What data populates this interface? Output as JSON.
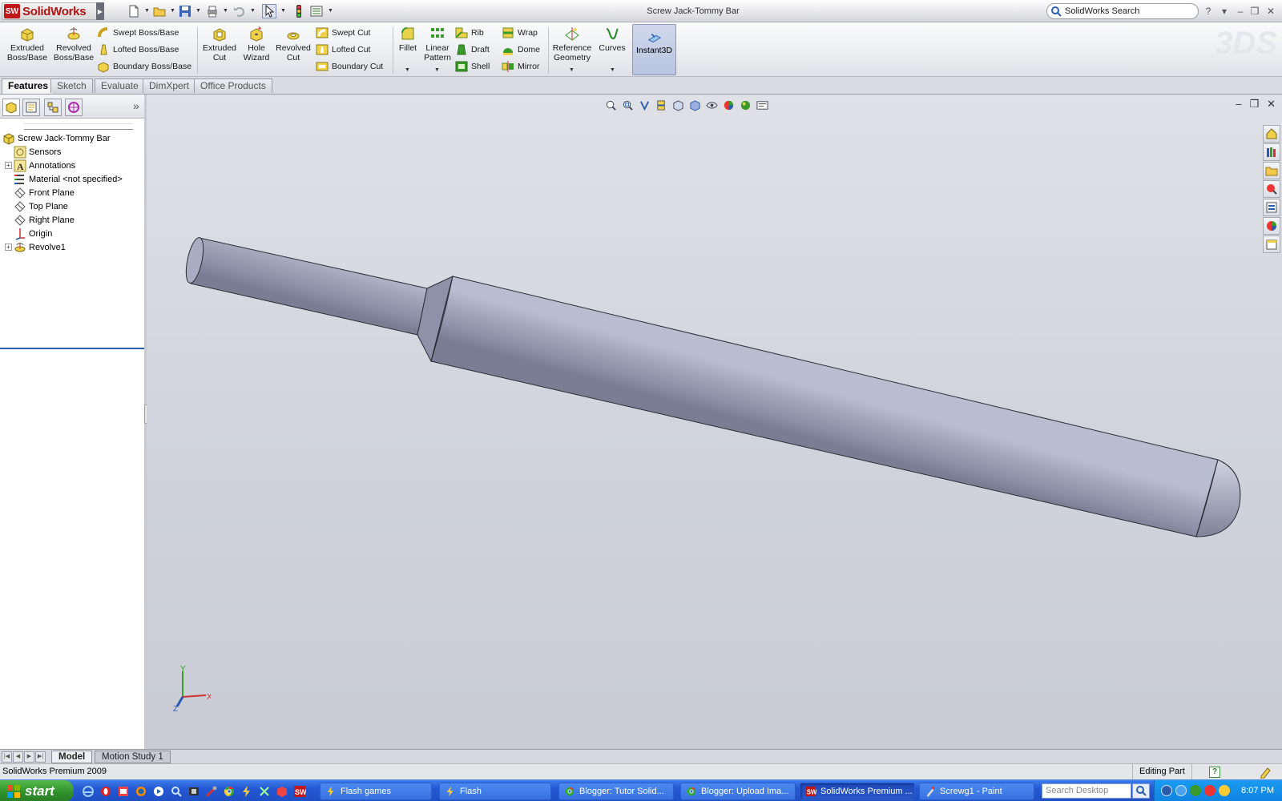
{
  "app": {
    "name": "SolidWorks",
    "badge": "SW"
  },
  "document_title": "Screw Jack-Tommy Bar",
  "search": {
    "placeholder": "SolidWorks Search"
  },
  "command_manager": {
    "extruded_boss": "Extruded Boss/Base",
    "revolved_boss": "Revolved Boss/Base",
    "swept_boss": "Swept Boss/Base",
    "lofted_boss": "Lofted Boss/Base",
    "boundary_boss": "Boundary Boss/Base",
    "extruded_cut": "Extruded Cut",
    "hole_wizard": "Hole Wizard",
    "revolved_cut": "Revolved Cut",
    "swept_cut": "Swept Cut",
    "lofted_cut": "Lofted Cut",
    "boundary_cut": "Boundary Cut",
    "fillet": "Fillet",
    "linear_pattern": "Linear Pattern",
    "rib": "Rib",
    "draft": "Draft",
    "shell": "Shell",
    "wrap": "Wrap",
    "dome": "Dome",
    "mirror": "Mirror",
    "reference_geometry": "Reference Geometry",
    "curves": "Curves",
    "instant3d": "Instant3D"
  },
  "tabs": [
    "Features",
    "Sketch",
    "Evaluate",
    "DimXpert",
    "Office Products"
  ],
  "feature_tree": {
    "root": "Screw Jack-Tommy Bar",
    "items": [
      {
        "label": "Sensors",
        "expandable": false,
        "icon": "sensors-icon"
      },
      {
        "label": "Annotations",
        "expandable": true,
        "icon": "annotations-icon"
      },
      {
        "label": "Material <not specified>",
        "expandable": false,
        "icon": "material-icon"
      },
      {
        "label": "Front Plane",
        "expandable": false,
        "icon": "plane-icon"
      },
      {
        "label": "Top Plane",
        "expandable": false,
        "icon": "plane-icon"
      },
      {
        "label": "Right Plane",
        "expandable": false,
        "icon": "plane-icon"
      },
      {
        "label": "Origin",
        "expandable": false,
        "icon": "origin-icon"
      },
      {
        "label": "Revolve1",
        "expandable": true,
        "icon": "revolve-icon"
      }
    ]
  },
  "triad": {
    "x": "X",
    "y": "Y",
    "z": "Z"
  },
  "bottom_tabs": [
    "Model",
    "Motion Study 1"
  ],
  "status": {
    "left": "SolidWorks Premium 2009",
    "mode": "Editing Part",
    "help": "?"
  },
  "taskbar": {
    "start": "start",
    "tasks": [
      {
        "label": "Flash games",
        "active": false
      },
      {
        "label": "Flash",
        "active": false
      },
      {
        "label": "Blogger: Tutor Solid...",
        "active": false
      },
      {
        "label": "Blogger: Upload Ima...",
        "active": false
      },
      {
        "label": "SolidWorks Premium ...",
        "active": true
      },
      {
        "label": "Screwg1 - Paint",
        "active": false
      }
    ],
    "search_placeholder": "Search Desktop",
    "clock": "8:07 PM"
  },
  "colors": {
    "accent": "#2a5cae",
    "part": "#9fa3b8",
    "brand": "#c01818"
  }
}
